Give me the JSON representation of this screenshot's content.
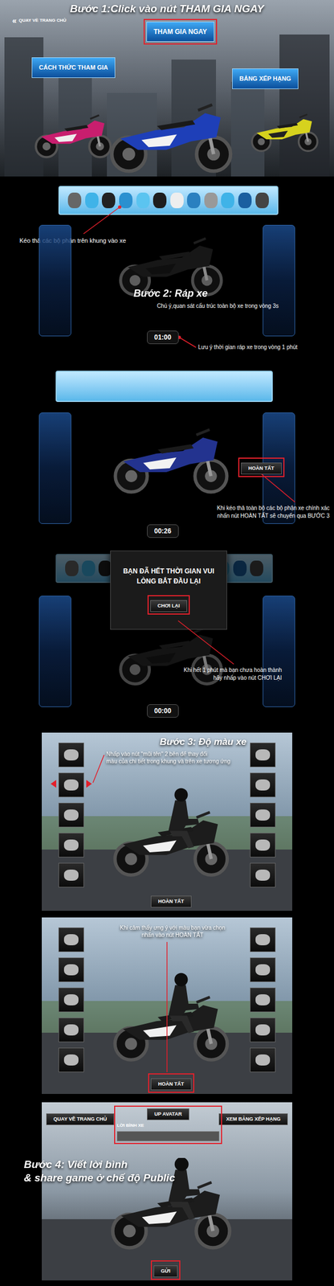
{
  "step1": {
    "title": "Bước 1:Click vào nút THAM GIA NGAY",
    "back_button": {
      "label": "QUAY VỀ TRANG CHỦ",
      "icon": "«"
    },
    "join_button": {
      "label": "THAM GIA NGAY",
      "highlighted": true
    },
    "how_to_button": {
      "label": "CÁCH THỨC THAM GIA",
      "highlighted": false
    },
    "ranking_button": {
      "label": "BẢNG XẾP HẠNG",
      "highlighted": false
    }
  },
  "step2": {
    "hint_parts": "Kéo thả các bộ phận trên khung vào xe",
    "title": "Bước 2: Ráp xe",
    "note": "Chú ý,quan sát cấu trúc toàn bộ xe trong vòng 3s",
    "timer": "01:00",
    "timer_note": "Lưu ý thời gian ráp xe trong vòng 1 phút"
  },
  "step2_done": {
    "finish_button": {
      "label": "HOÀN TẤT",
      "highlighted": true
    },
    "note_lines": [
      "Khi kéo thả toàn bộ các bộ phận xe chính xác",
      "nhấn nút HOÀN TẤT sẽ chuyển qua BƯỚC 3"
    ],
    "timer": "00:26"
  },
  "timeout": {
    "message_lines": [
      "BẠN ĐÃ HẾT THỜI GIAN VUI",
      "LÒNG BẮT ĐẦU LẠI"
    ],
    "replay_button": {
      "label": "CHƠI LẠI",
      "highlighted": true
    },
    "note_lines": [
      "Khi hết 1 phút mà bạn chưa hoàn thành",
      "hãy nhấp vào nút CHƠI LẠI"
    ],
    "timer": "00:00"
  },
  "step3": {
    "title": "Bước 3: Độ màu xe",
    "note_lines": [
      "Nhấp vào nút \"mũi tên\" 2 bên để thay đổi",
      "màu của chi tiết trong khung và trên xe tương ứng"
    ],
    "finish_button": {
      "label": "HOÀN TẤT",
      "highlighted": false
    }
  },
  "step3_done": {
    "note_lines": [
      "Khi cảm thấy ưng ý với màu bạn vừa chọn",
      "nhấn vào nút HOÀN TẤT"
    ],
    "finish_button": {
      "label": "HOÀN TẤT",
      "highlighted": true
    }
  },
  "step4": {
    "back_button": "QUAY VỀ TRANG CHỦ",
    "avatar_box": {
      "button": "UP AVATAR",
      "comment_label": "LỜI BÌNH XE",
      "highlighted": true
    },
    "ranking_button": "XEM BẢNG XẾP HẠNG",
    "title_lines": [
      "Bước 4: Viết lời bình",
      "& share game ở chế độ Public"
    ],
    "send_button": {
      "label": "GỬI",
      "highlighted": true
    }
  }
}
